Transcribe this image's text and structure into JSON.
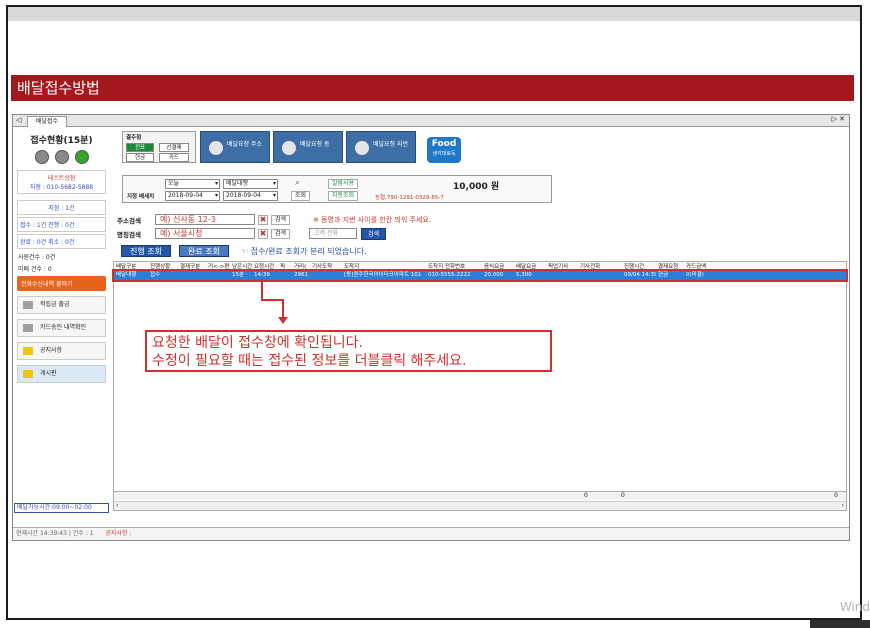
{
  "slide": {
    "title": "배달접수방법"
  },
  "app": {
    "tab_label": "배달접수",
    "nav_left": "◁",
    "nav_right": "▷ ✕",
    "sidebar": {
      "title": "접수현황(15분)",
      "store_name": "테스트상점",
      "store_phone": "지점 : 010-5682-5888",
      "branch": "지점 : 1건",
      "stats_row1": "접수 : 1건   전행 : 0건",
      "stats_row2": "완료 : 0건   취소 : 0건",
      "rider_count": "사원건수 : 0건",
      "today_count": "미배 건수 : 0",
      "orange_btn": "전화수신내역 불러기",
      "menu": [
        "적립금 출금",
        "카드승인 내역확인",
        "공지사항",
        "게시판"
      ],
      "time_status": "배달가능시간:09:00~02:00"
    },
    "toolbar": {
      "pay_title": "결주점",
      "chips": [
        "전표",
        "선결제",
        "현금",
        "카드"
      ],
      "buttons": [
        "배달요청 주소",
        "배달요청 동",
        "배달요청 지번"
      ],
      "food_label": "Food",
      "food_sub": "생각대로독"
    },
    "filters": {
      "period": "오늘",
      "type": "배달대행",
      "date_from": "2018-09-04",
      "date_to": "2018-09-04",
      "left_label": "지정 배세치",
      "search_btn": "조회",
      "check1": "알람사용",
      "check2": "자동조회",
      "money": "10,000 원",
      "notice": "농협,790-1291-0329-85-7"
    },
    "search": {
      "address_label": "주소검색",
      "address_value": "예) 신사동 12-3",
      "name_label": "명칭검색",
      "name_value": "예) 서울시청",
      "search_btn1": "검색",
      "search_btn2": "검색",
      "note": "※ 동명과 지번 사이를 한칸 띄워 주세요.",
      "customer_placeholder": "고객 전화",
      "customer_btn": "검색"
    },
    "view": {
      "progress_btn": "진행 조회",
      "done_btn": "완료 조회",
      "note": "☜ 접수/완료 조회가 분리 되었습니다."
    },
    "grid": {
      "columns": [
        "배달구분",
        "진행상황",
        "결제구분",
        "거<->편",
        "남은시간",
        "요청시간",
        "픽",
        "거리(",
        "기사도착",
        "도착지",
        "도착지 전화번호",
        "음식요금",
        "배달요금",
        "픽업기사",
        "기사전화",
        "진행시간",
        "결제요청",
        "카드금액"
      ],
      "row": [
        "배달대행",
        "접수",
        "",
        "",
        "15분",
        "14:39",
        "",
        "2961",
        "",
        "[동]원주한국아이티크아파트 101",
        "010-5555-2222",
        "20,000",
        "5,300",
        "",
        "",
        "09/04 14:39",
        "현금",
        "0(미결)"
      ],
      "foot_a": "0",
      "foot_b": "0",
      "foot_c": "0"
    },
    "status_bar": {
      "time": "현재시간 14:39:43 | 건수 : 1",
      "notice": "공지사항 :"
    }
  },
  "callout": {
    "line1": "요청한 배달이 접수창에 확인됩니다.",
    "line2": "수정이 필요할 때는 접수된 정보를 더블클릭 해주세요."
  },
  "watermark": "Wind"
}
